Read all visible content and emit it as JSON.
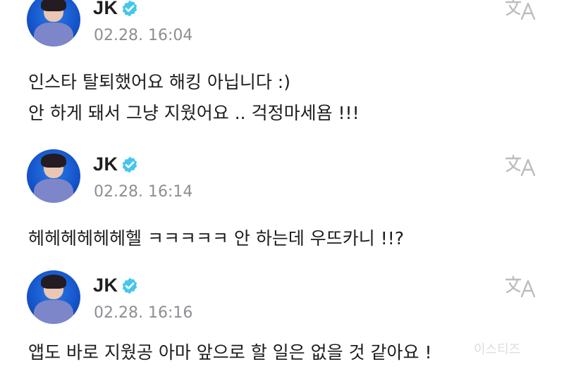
{
  "posts": [
    {
      "author": "JK",
      "timestamp": "02.28. 16:04",
      "lines": [
        "인스타 탈퇴했어요 해킹 아닙니다 :)",
        "안 하게 돼서 그냥 지웠어요 .. 걱정마세욤 !!!"
      ]
    },
    {
      "author": "JK",
      "timestamp": "02.28. 16:14",
      "lines": [
        "헤헤헤헤헤헤헬 ㅋㅋㅋㅋㅋ 안 하는데 우뜨카니 !!?"
      ]
    },
    {
      "author": "JK",
      "timestamp": "02.28. 16:16",
      "lines": [
        "앱도 바로 지웠공 아마 앞으로 할 일은 없을 것 같아요 !"
      ]
    }
  ],
  "icons": {
    "verified": "verified-badge-icon",
    "translate": "translate-icon"
  },
  "colors": {
    "verified_badge": "#44c6ee",
    "timestamp": "#8e8e93",
    "translate_icon": "#bdbdbd"
  },
  "watermark": "이스티즈"
}
